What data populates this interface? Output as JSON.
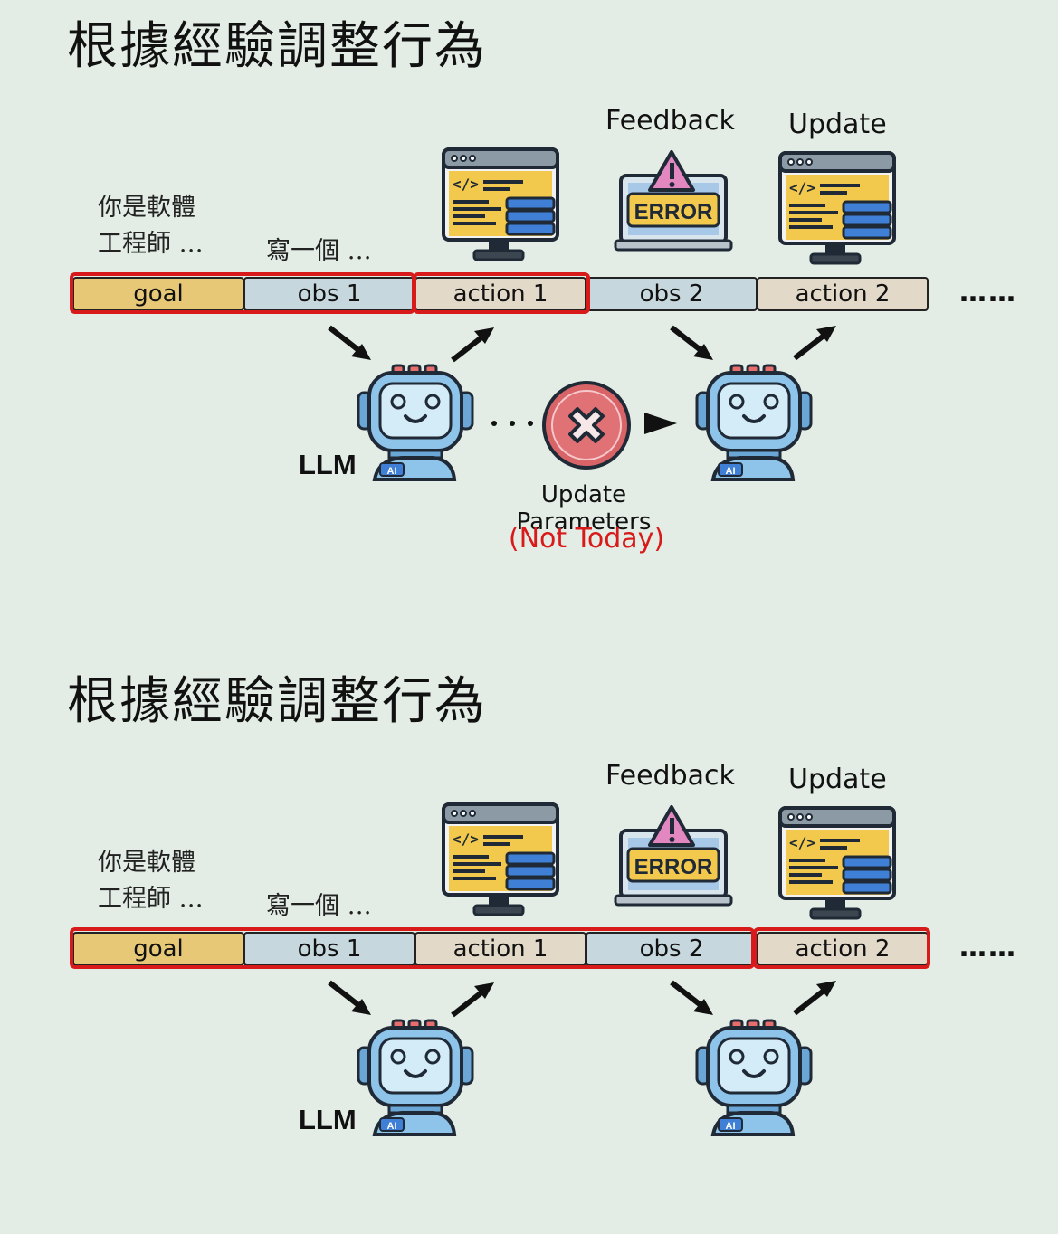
{
  "panels": [
    {
      "title": "根據經驗調整行為",
      "prompt_line1": "你是軟體",
      "prompt_line2": "工程師 …",
      "request": "寫一個 …",
      "feedback_label": "Feedback",
      "update_label": "Update",
      "error_text": "ERROR",
      "sequence": [
        "goal",
        "obs 1",
        "action 1",
        "obs 2",
        "action 2"
      ],
      "ellipsis": "……",
      "llm_label": "LLM",
      "robot_badge": "AI",
      "update_params_line1": "Update",
      "update_params_line2": "Parameters",
      "not_today": "(Not Today)",
      "highlighted": [
        "goal + obs 1",
        "action 1"
      ]
    },
    {
      "title": "根據經驗調整行為",
      "prompt_line1": "你是軟體",
      "prompt_line2": "工程師 …",
      "request": "寫一個 …",
      "feedback_label": "Feedback",
      "update_label": "Update",
      "error_text": "ERROR",
      "sequence": [
        "goal",
        "obs 1",
        "action 1",
        "obs 2",
        "action 2"
      ],
      "ellipsis": "……",
      "llm_label": "LLM",
      "robot_badge": "AI",
      "highlighted": [
        "goal + obs 1 + action 1 + obs 2",
        "action 2"
      ]
    }
  ],
  "colors": {
    "background": "#e3ede6",
    "highlight": "#d81a1a",
    "goal": "#e6c877",
    "obs": "#c6d8de",
    "action": "#e2d9c8"
  },
  "icons": [
    "computer-code-icon",
    "laptop-error-icon",
    "robot-icon",
    "cancel-icon",
    "arrow-icon"
  ]
}
